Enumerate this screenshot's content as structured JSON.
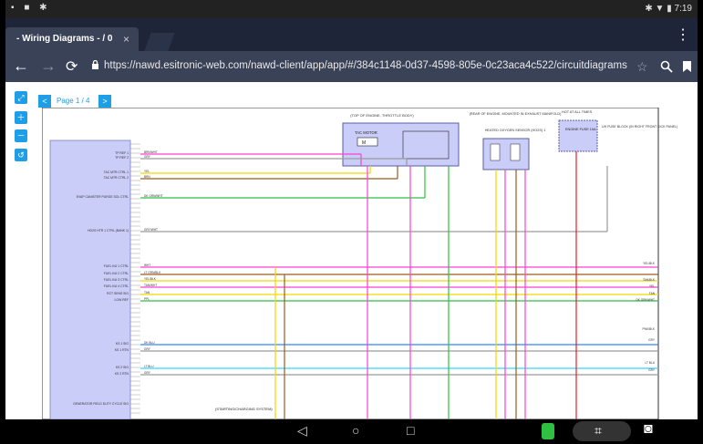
{
  "status": {
    "time": "7:19"
  },
  "tab": {
    "title": "- Wiring Diagrams - / 0",
    "close": "×"
  },
  "address": {
    "url": "https://nawd.esitronic-web.com/nawd-client/app/app/#/384c1148-0d37-4598-805e-0c23aca4c522/circuitdiagrams"
  },
  "viewer": {
    "page_label": "Page 1 / 4",
    "prev_label": "<",
    "next_label": ">",
    "tools": [
      "expand-icon",
      "zoom-in-icon",
      "zoom-out-icon",
      "reset-icon"
    ]
  },
  "diagram": {
    "ecm_labels": [
      "TP REF 1",
      "TP REF 2",
      "TAC MTR CTRL 1",
      "TAC MTR CTRL 2",
      "EVAP CANISTER PURGE SOL CTRL",
      "HO2S HTR 1 CTRL (BANK 1)",
      "FUEL INJ 1 CTRL",
      "FUEL INJ 2 CTRL",
      "FUEL INJ 3 CTRL",
      "FUEL INJ 4 CTRL",
      "RCT SENS SIG",
      "LOW REF",
      "KS 1 SIG",
      "KS 1 RTN",
      "KS 2 SIG",
      "KS 2 RTN",
      "GENERATOR FIELD DUTY CYCLE SIG"
    ],
    "wire_labels": [
      "BRN/WHT",
      "GRY",
      "YEL",
      "BRN",
      "DK GRN/WHT",
      "GRY/WHT",
      "WHT",
      "LT GRN/BLK",
      "YEL/BLK",
      "TAN/WHT",
      "TAN",
      "PPL",
      "DK BLU",
      "GRY",
      "LT BLU",
      "GRY"
    ],
    "component_throttle": "TAC MOTOR",
    "component_throttle_note": "(TOP OF ENGINE, THROTTLE BODY)",
    "component_o2": "HEATED OXYGEN SENSOR (HO2S) 1",
    "component_o2_note": "(REAR OF ENGINE, MOUNTED IN EXHAUST MANIFOLD)",
    "component_fuse": "ENGINE FUSE 10A",
    "component_fuse_note": "HOT AT ALL TIMES",
    "component_fuse_block": "UH FUSE BLOCK (IN RIGHT FRONT KICK PANEL)",
    "right_labels": [
      "YEL/BLK",
      "TAN/BLK",
      "YEL",
      "TAN",
      "DK GRN/WHT",
      "PNK/BLK",
      "GRY",
      "LT BLU",
      "GRY"
    ],
    "generator_note": "(STARTING/CHARGING SYSTEM)"
  },
  "colors": {
    "tabbar": "#1e2538",
    "urlbar": "#3a4258",
    "ecm_fill": "#c9cdf7",
    "tool_blue": "#1e9ee6",
    "wire_pink": "#ff3fd2",
    "wire_yellow": "#f2d700",
    "wire_green": "#2fc042",
    "wire_brown": "#9b5a1e",
    "wire_blue": "#2e86ff",
    "wire_cyan": "#34d6ff",
    "wire_red": "#e2202a",
    "wire_gray": "#9a9a9a"
  }
}
